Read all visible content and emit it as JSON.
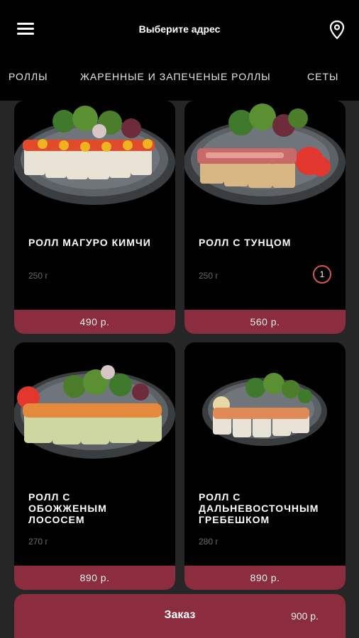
{
  "header": {
    "title": "Выберите адрес",
    "menu_icon": "hamburger-menu-icon",
    "location_icon": "location-pin-icon"
  },
  "categories": [
    {
      "label": "РОЛЛЫ"
    },
    {
      "label": "ЖАРЕННЫЕ И ЗАПЕЧЕНЫЕ РОЛЛЫ"
    },
    {
      "label": "СЕТЫ"
    }
  ],
  "products": [
    {
      "name": "РОЛЛ МАГУРО КИМЧИ",
      "weight": "250 г",
      "price": "490 р."
    },
    {
      "name": "РОЛЛ С  ТУНЦОМ",
      "weight": "250 г",
      "price": "560 р.",
      "quantity": "1"
    },
    {
      "name_lines": [
        "РОЛЛ С",
        "ОБОЖЖЕНЫМ",
        "ЛОСОСЕМ"
      ],
      "weight": "270 г",
      "price": "890 р."
    },
    {
      "name_lines": [
        "РОЛЛ С",
        "ДАЛЬНЕВОСТОЧНЫМ",
        "ГРЕБЕШКОМ"
      ],
      "weight": "280 г",
      "price": "890 р."
    }
  ],
  "order": {
    "label": "Заказ",
    "total": "900 р."
  },
  "colors": {
    "accent": "#8b2c3f",
    "badge_ring": "#d45757",
    "background": "#262626",
    "card": "#000000"
  }
}
